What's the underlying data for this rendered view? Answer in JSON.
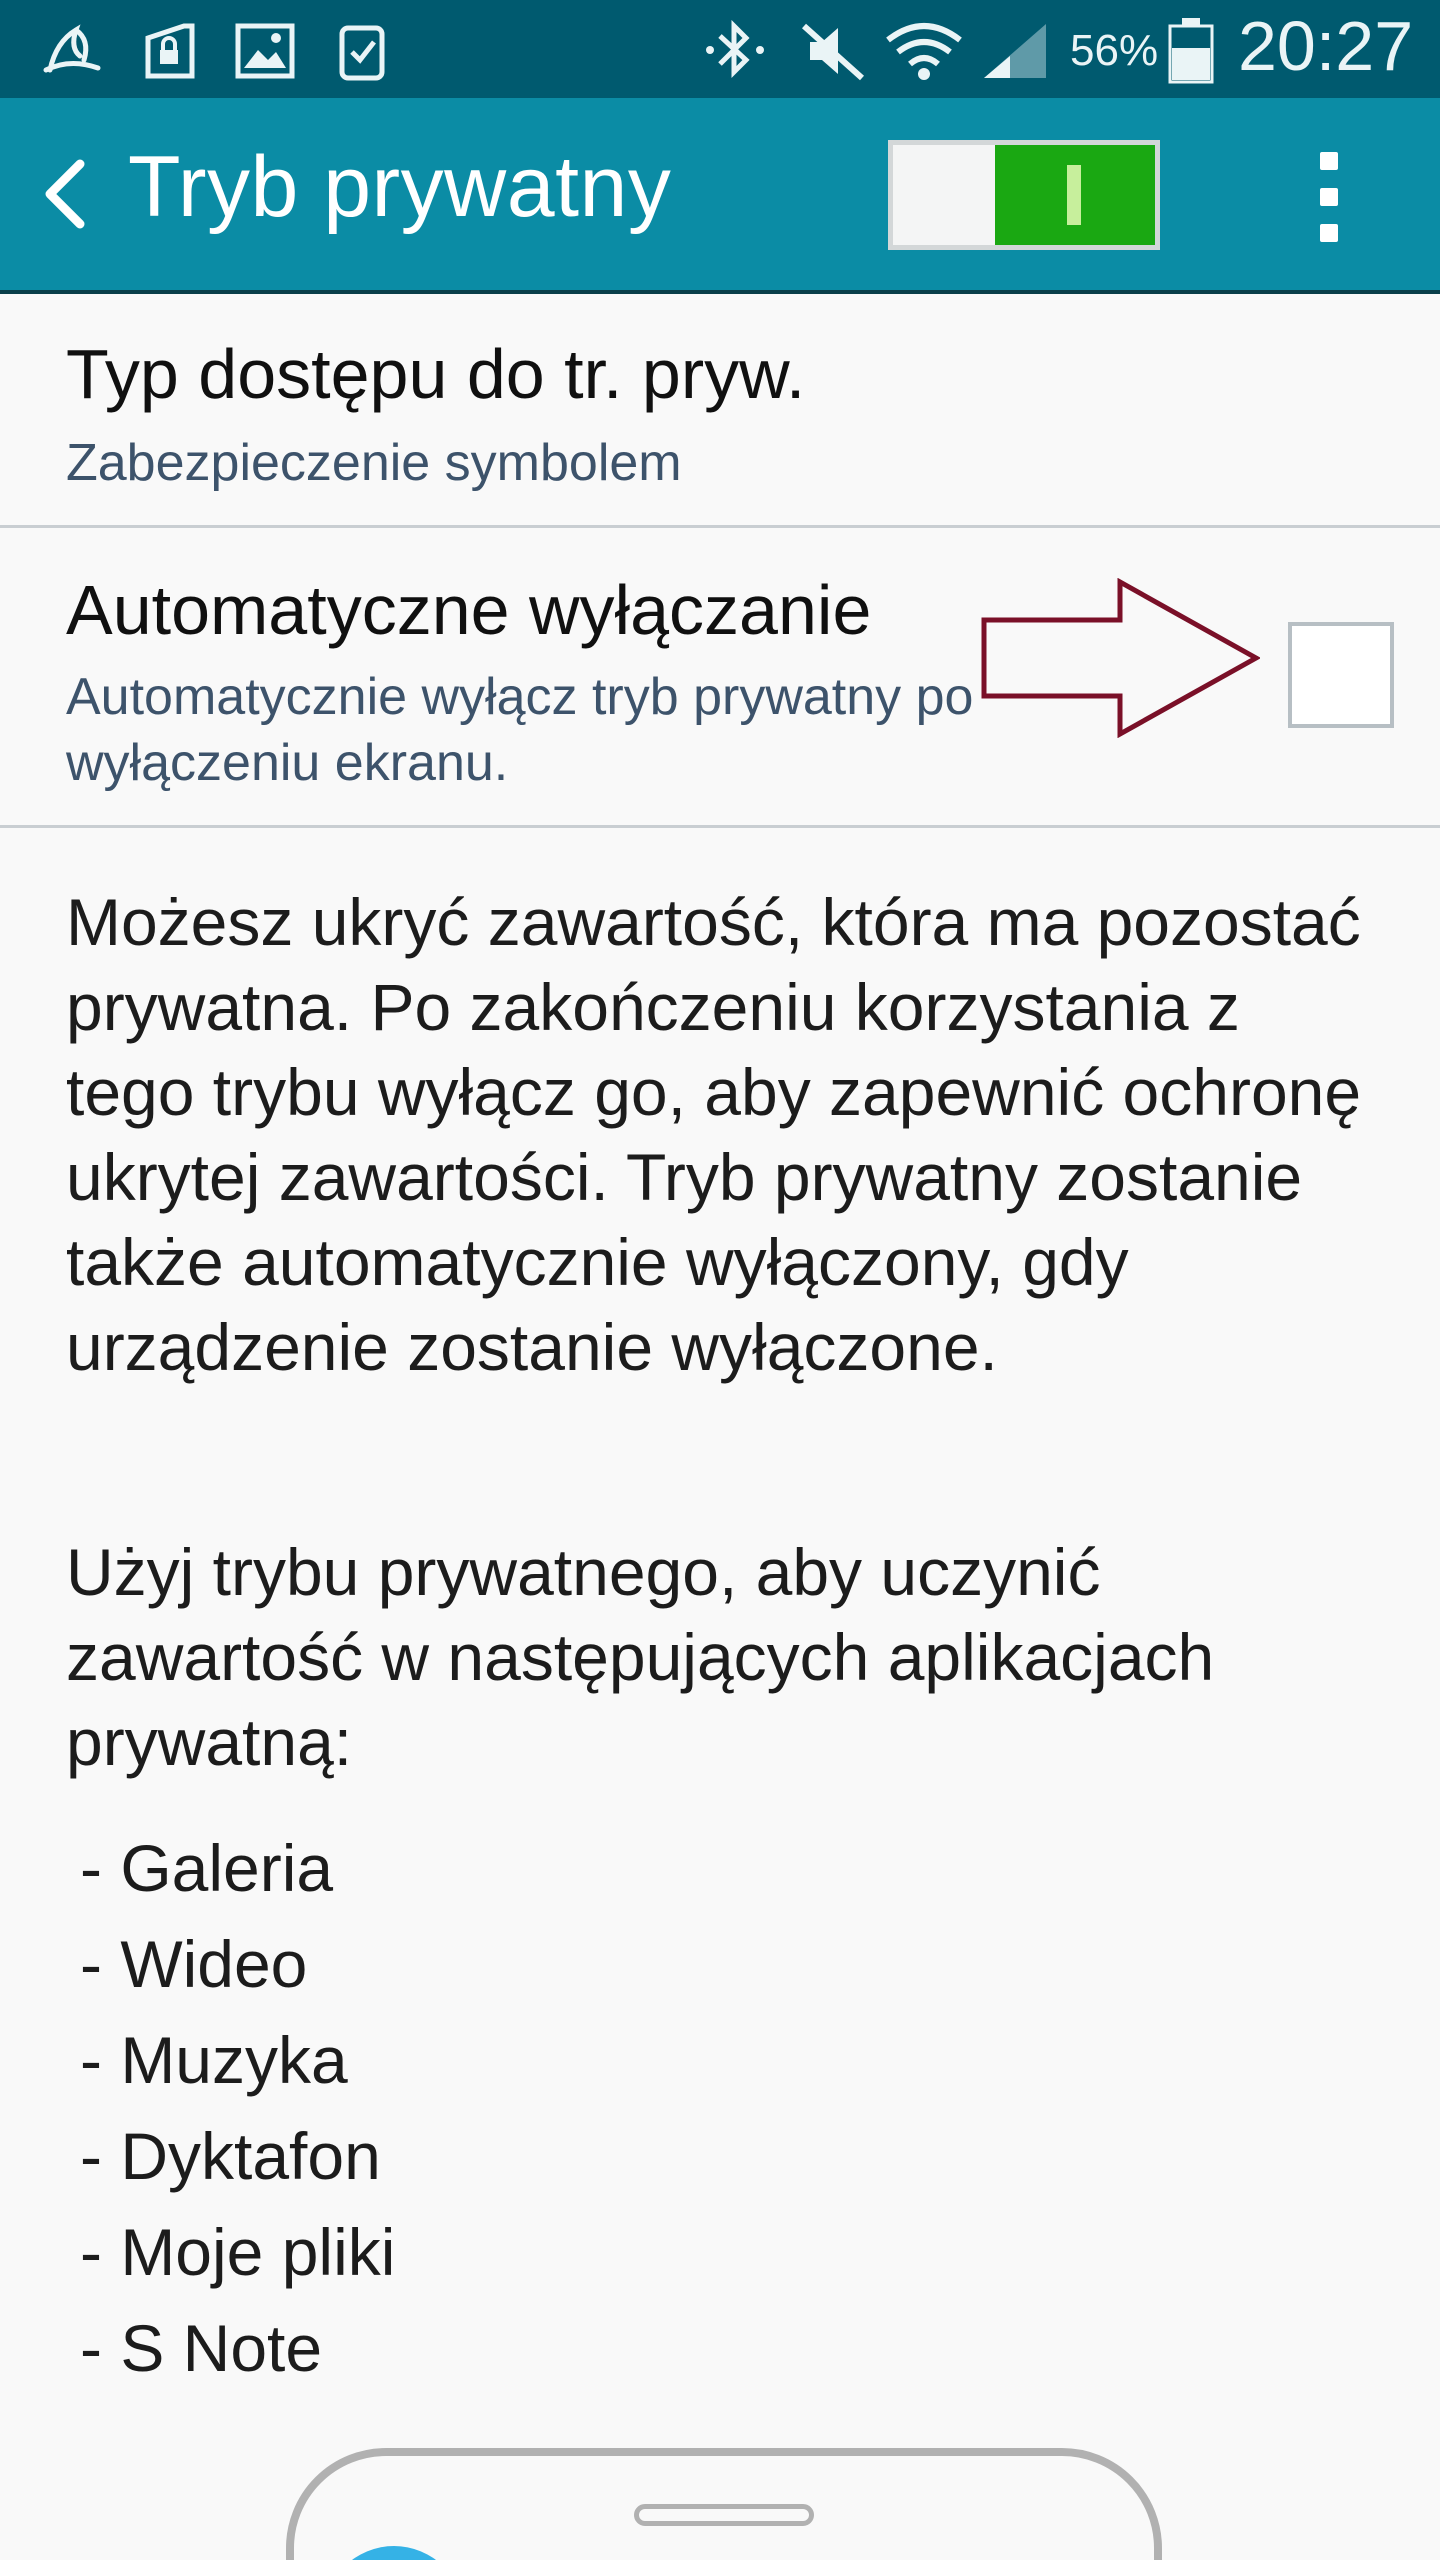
{
  "status_bar": {
    "battery_percent": "56%",
    "time": "20:27",
    "icons": [
      "bird-notification-icon",
      "lock-notification-icon",
      "image-notification-icon",
      "checklist-notification-icon",
      "bluetooth-icon",
      "mute-icon",
      "wifi-icon",
      "signal-icon",
      "battery-icon"
    ]
  },
  "action_bar": {
    "title": "Tryb prywatny",
    "master_switch_on": true
  },
  "settings": [
    {
      "title": "Typ dostępu do tr. pryw.",
      "subtitle": "Zabezpieczenie symbolem"
    },
    {
      "title": "Automatyczne wyłączanie",
      "subtitle": "Automatycznie wyłącz tryb prywatny po wyłączeniu ekranu.",
      "checked": false
    }
  ],
  "info": {
    "paragraph_1": "Możesz ukryć zawartość, która ma pozostać prywatna. Po zakończeniu korzystania z tego trybu wyłącz go, aby zapewnić ochronę ukrytej zawartości. Tryb prywatny zostanie także automatycznie wyłączony, gdy urządzenie zostanie wyłączone.",
    "paragraph_2": "Użyj trybu prywatnego, aby uczynić zawartość w następujących aplikacjach prywatną:",
    "apps": [
      "- Galeria",
      "- Wideo",
      "- Muzyka",
      "- Dyktafon",
      "- Moje pliki",
      "- S Note"
    ]
  },
  "colors": {
    "status_bar": "#005a6f",
    "action_bar": "#0b8ca5",
    "switch_on": "#1aa812",
    "annotation_arrow": "#7a1028"
  }
}
